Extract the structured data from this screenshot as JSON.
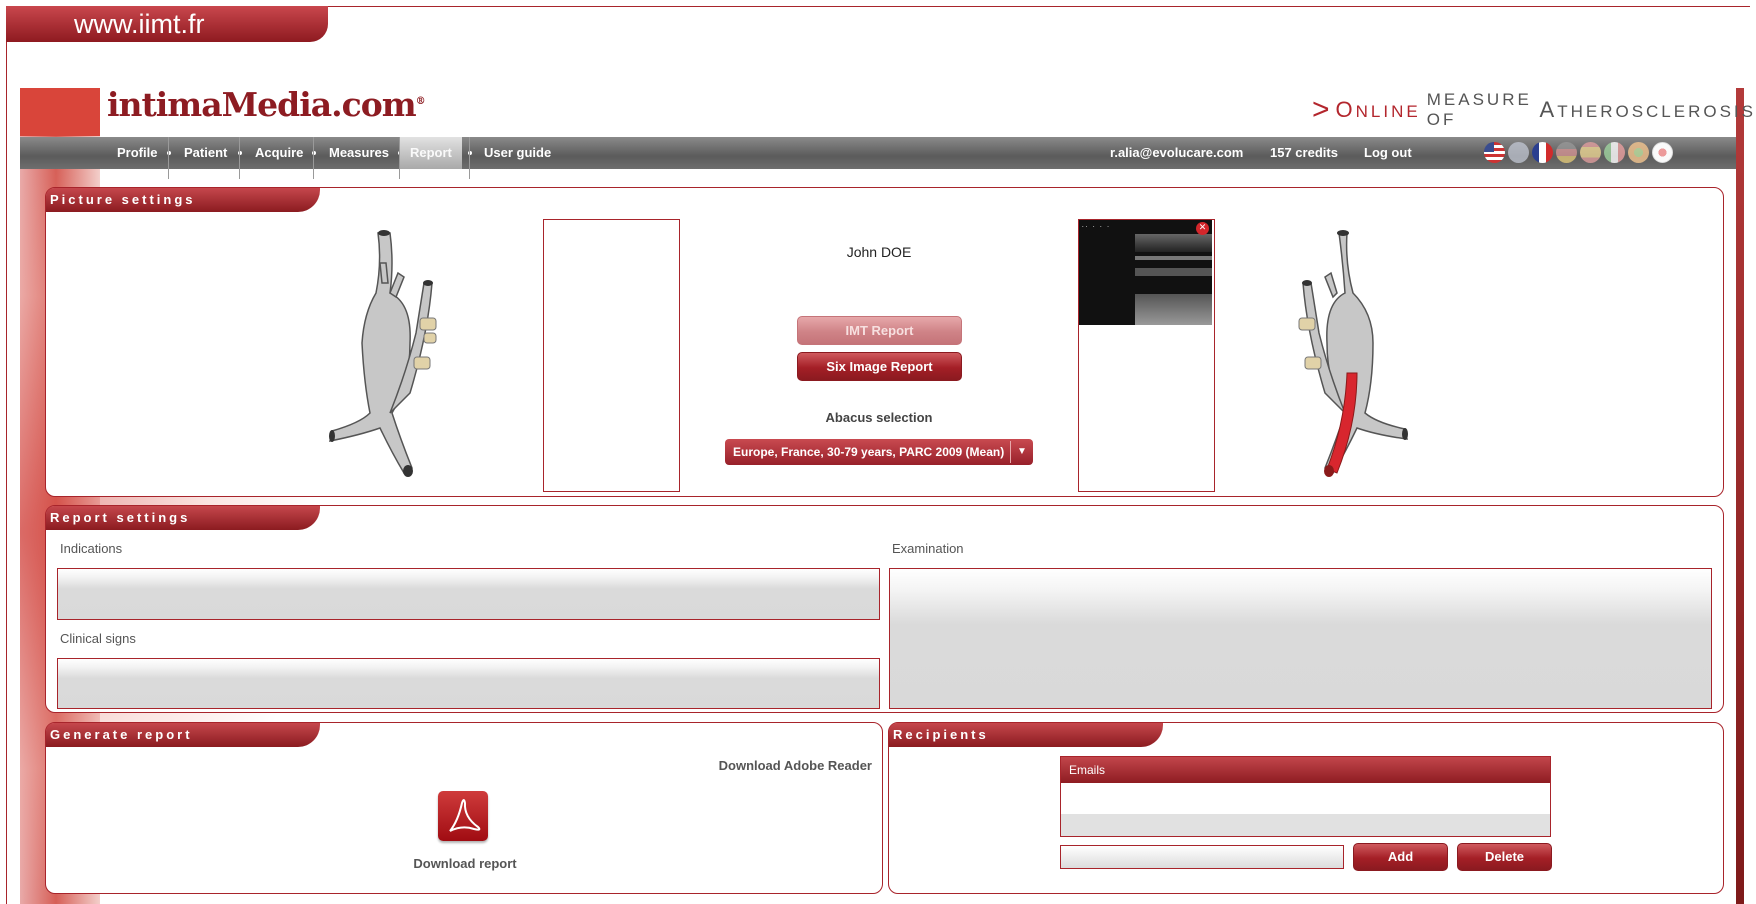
{
  "site": {
    "url_tab": "www.iimt.fr"
  },
  "header": {
    "logo": "intimaMedia.com",
    "tagline": {
      "first_letter": "O",
      "rest_first_word": "NLINE",
      "middle": "MEASURE OF",
      "big_letter": "A",
      "last": "THEROSCLEROSIS"
    }
  },
  "nav": {
    "items": [
      {
        "label": "Profile"
      },
      {
        "label": "Patient"
      },
      {
        "label": "Acquire"
      },
      {
        "label": "Measures"
      },
      {
        "label": "Report"
      },
      {
        "label": "User guide"
      }
    ],
    "active": "Report",
    "user_email": "r.alia@evolucare.com",
    "credits": "157 credits",
    "logout": "Log out",
    "flags": [
      "us-flag-icon",
      "uk-flag-icon",
      "fr-flag-icon",
      "de-flag-icon",
      "es-flag-icon",
      "it-flag-icon",
      "jp-flag-icon"
    ]
  },
  "picture_settings": {
    "title": "Picture settings",
    "patient_name": "John DOE",
    "imt_report_button": "IMT Report",
    "six_image_button": "Six Image Report",
    "abacus_label": "Abacus selection",
    "abacus_selected": "Europe, France, 30-79 years, PARC 2009 (Mean)"
  },
  "report_settings": {
    "title": "Report settings",
    "indications_label": "Indications",
    "clinical_signs_label": "Clinical signs",
    "examination_label": "Examination",
    "indications_value": "",
    "clinical_signs_value": "",
    "examination_value": ""
  },
  "generate_report": {
    "title": "Generate report",
    "download_adobe": "Download Adobe Reader",
    "download_report": "Download report"
  },
  "recipients": {
    "title": "Recipients",
    "emails_header": "Emails",
    "email_input_value": "",
    "add_button": "Add",
    "delete_button": "Delete"
  },
  "colors": {
    "brand_red": "#a8242b",
    "nav_gray": "#6b6b6b",
    "artery_highlight": "#d8262e"
  }
}
